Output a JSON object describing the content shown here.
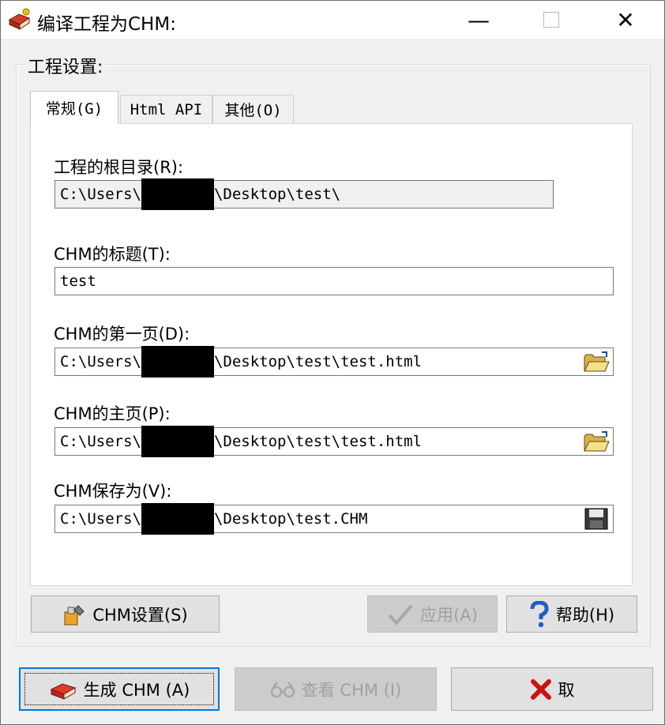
{
  "window": {
    "title": "编译工程为CHM:",
    "minimize_glyph": "—",
    "close_glyph": "✕"
  },
  "group": {
    "label": "工程设置:"
  },
  "tabs": [
    {
      "label": "常规(G)",
      "active": true
    },
    {
      "label": "Html API",
      "active": false
    },
    {
      "label": "其他(O)",
      "active": false
    }
  ],
  "fields": {
    "root_dir": {
      "label": "工程的根目录(R):",
      "value_prefix": "C:\\Users\\",
      "value_suffix": "\\Desktop\\test\\"
    },
    "title": {
      "label": "CHM的标题(T):",
      "value": "test"
    },
    "first_page": {
      "label": "CHM的第一页(D):",
      "value_prefix": "C:\\Users\\",
      "value_suffix": "\\Desktop\\test\\test.html"
    },
    "home_page": {
      "label": "CHM的主页(P):",
      "value_prefix": "C:\\Users\\",
      "value_suffix": "\\Desktop\\test\\test.html"
    },
    "save_as": {
      "label": "CHM保存为(V):",
      "value_prefix": "C:\\Users\\",
      "value_suffix": "\\Desktop\\test.CHM"
    }
  },
  "buttons": {
    "chm_settings": "CHM设置(S)",
    "apply": "应用(A)",
    "help": "帮助(H)",
    "generate": "生成 CHM (A)",
    "view": "查看 CHM (I)",
    "cancel": "取"
  },
  "colors": {
    "accent": "#0078d7",
    "face": "#f0f0f0",
    "cancel_x": "#cc1111"
  }
}
